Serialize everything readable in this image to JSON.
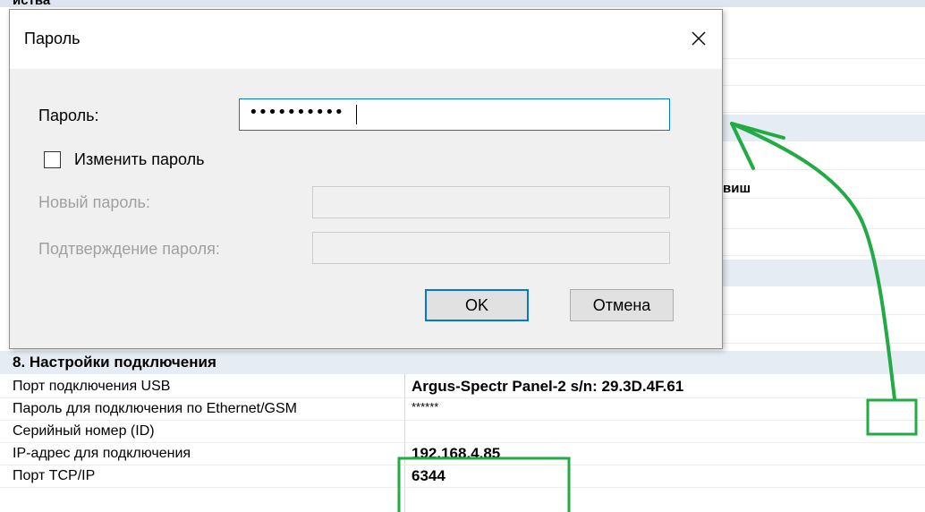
{
  "background": {
    "top_label": "иства",
    "fragment_text": "виш",
    "section_title": "8. Настройки подключения",
    "rows": [
      {
        "name": "Порт подключения USB",
        "value": "Argus-Spectr Panel-2 s/n: 29.3D.4F.61"
      },
      {
        "name": "Пароль для подключения по Ethernet/GSM",
        "value": "******"
      },
      {
        "name": "Серийный номер (ID)",
        "value": ""
      },
      {
        "name": "IP-адрес для подключения",
        "value": "192.168.4.85"
      },
      {
        "name": "Порт TCP/IP",
        "value": "6344"
      }
    ]
  },
  "dialog": {
    "title": "Пароль",
    "close_icon": "close-icon",
    "password_label": "Пароль:",
    "password_value": "••••••••••",
    "change_password_checkbox": {
      "label": "Изменить пароль",
      "checked": false
    },
    "new_password_label": "Новый пароль:",
    "confirm_password_label": "Подтверждение пароля:",
    "ok_label": "OK",
    "cancel_label": "Отмена"
  },
  "annotation_color": "#22aa44",
  "colors": {
    "accent": "#0078d7",
    "section_bg": "#e6ecf3",
    "dialog_bg": "#f0f0f0"
  }
}
